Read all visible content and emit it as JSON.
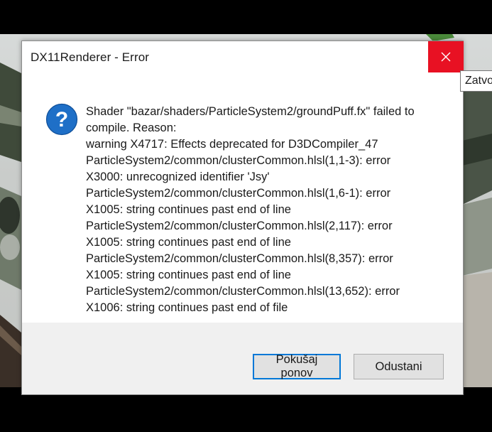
{
  "dialog": {
    "title": "DX11Renderer - Error",
    "close_tooltip": "Zatvo",
    "icon": "question-icon",
    "message_lines": [
      "Shader \"bazar/shaders/ParticleSystem2/groundPuff.fx\" failed to",
      "compile. Reason:",
      "warning X4717: Effects deprecated for D3DCompiler_47",
      "ParticleSystem2/common/clusterCommon.hlsl(1,1-3): error",
      "X3000: unrecognized identifier 'Jsy'",
      "ParticleSystem2/common/clusterCommon.hlsl(1,6-1): error",
      "X1005: string continues past end of line",
      "ParticleSystem2/common/clusterCommon.hlsl(2,117): error",
      "X1005: string continues past end of line",
      "ParticleSystem2/common/clusterCommon.hlsl(8,357): error",
      "X1005: string continues past end of line",
      "ParticleSystem2/common/clusterCommon.hlsl(13,652): error",
      "X1006: string continues past end of file"
    ],
    "buttons": {
      "retry_label": "Pokušaj ponov",
      "cancel_label": "Odustani"
    }
  },
  "colors": {
    "close_red": "#e81123",
    "icon_blue": "#1e6fc7",
    "focus_blue": "#0078d7",
    "footer_gray": "#f0f0f0"
  }
}
